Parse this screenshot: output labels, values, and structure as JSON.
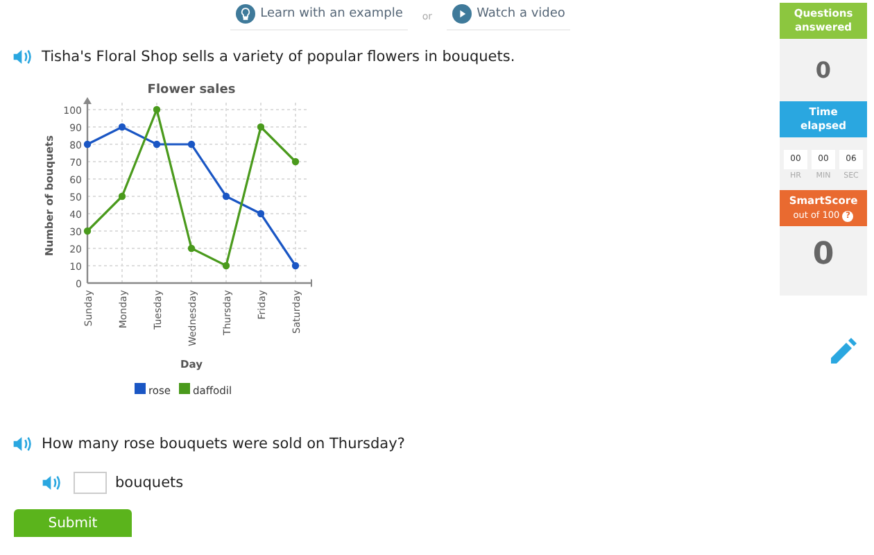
{
  "help_links": [
    {
      "kind": "example",
      "label": "Learn with an example"
    },
    {
      "kind": "separator",
      "label": "or"
    },
    {
      "kind": "video",
      "label": "Watch a video"
    }
  ],
  "intro": "Tisha's Floral Shop sells a variety of popular flowers in bouquets.",
  "chart_data": {
    "type": "line",
    "title": "Flower sales",
    "xlabel": "Day",
    "ylabel": "Number of bouquets",
    "categories": [
      "Sunday",
      "Monday",
      "Tuesday",
      "Wednesday",
      "Thursday",
      "Friday",
      "Saturday"
    ],
    "series": [
      {
        "name": "rose",
        "color": "#1a56c4",
        "marker": true,
        "values": [
          80,
          90,
          80,
          80,
          50,
          40,
          10
        ]
      },
      {
        "name": "daffodil",
        "color": "#4a9a1c",
        "marker": true,
        "values": [
          30,
          50,
          100,
          20,
          10,
          90,
          70
        ]
      }
    ],
    "grid": true,
    "legend": true,
    "ylim": [
      0,
      100
    ],
    "yticks": [
      0,
      10,
      20,
      30,
      40,
      50,
      60,
      70,
      80,
      90,
      100
    ]
  },
  "question": "How many rose bouquets were sold on Thursday?",
  "answer": {
    "unit": "bouquets"
  },
  "submit": "Submit",
  "sidebar": {
    "questions_label": "Questions answered",
    "questions_value": "0",
    "time_label": "Time elapsed",
    "timer": [
      {
        "value": "00",
        "unit": "HR"
      },
      {
        "value": "00",
        "unit": "MIN"
      },
      {
        "value": "06",
        "unit": "SEC"
      }
    ],
    "score_label": "SmartScore",
    "score_sub": "out of 100",
    "score_help": "?",
    "score_value": "0"
  }
}
